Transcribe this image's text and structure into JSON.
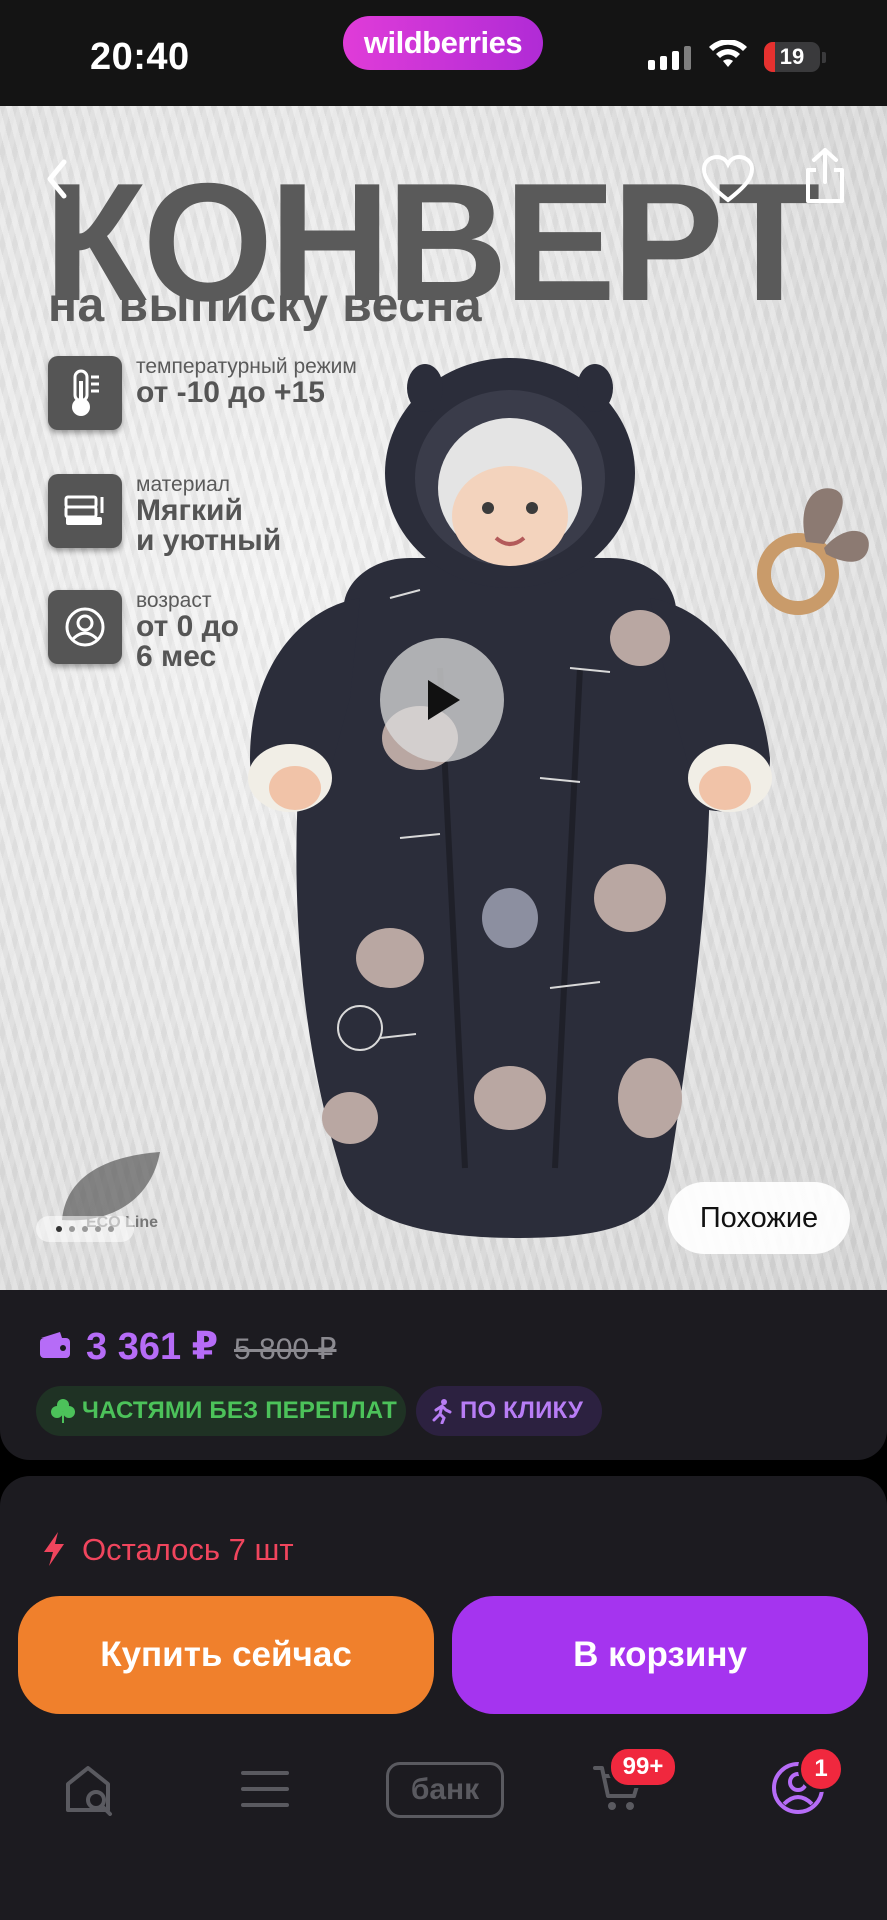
{
  "status_bar": {
    "time": "20:40",
    "brand": "wildberries",
    "battery": "19"
  },
  "hero": {
    "title": "КОНВЕРТ",
    "subtitle": "на выписку весна",
    "features": [
      {
        "icon": "thermometer-icon",
        "label": "температурный режим",
        "value_line1": "от -10 до +15",
        "value_line2": ""
      },
      {
        "icon": "fabric-icon",
        "label": "материал",
        "value_line1": "Мягкий",
        "value_line2": "и уютный"
      },
      {
        "icon": "baby-icon",
        "label": "возраст",
        "value_line1": "от 0 до",
        "value_line2": "6 мес"
      }
    ],
    "eco_logo_text": "ECO Line",
    "similar_button": "Похожие",
    "carousel": {
      "total": 5,
      "active": 1
    }
  },
  "price": {
    "current": "3 361 ₽",
    "old": "5 800 ₽",
    "chip_installments": "ЧАСТЯМИ БЕЗ ПЕРЕПЛАТ",
    "chip_oneclick": "ПО КЛИКУ"
  },
  "purchase": {
    "stock_text": "Осталось 7 шт",
    "buy_now": "Купить сейчас",
    "add_to_cart": "В корзину"
  },
  "tabbar": {
    "bank_label": "банк",
    "cart_badge": "99+",
    "profile_badge": "1"
  },
  "colors": {
    "brand": "#cb3ad8",
    "price": "#b66cf7",
    "buy": "#f0802c",
    "cart": "#a534ef",
    "alert": "#f0455d",
    "chip_green": "#4cc25a"
  }
}
